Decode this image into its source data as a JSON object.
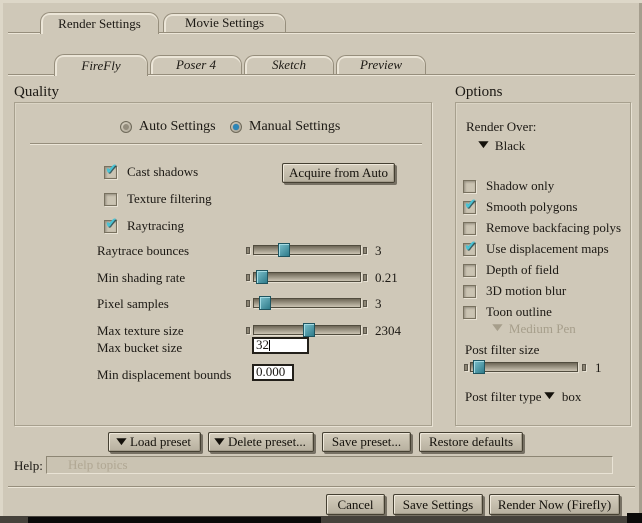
{
  "tabs": {
    "main": [
      {
        "label": "Render Settings",
        "active": true
      },
      {
        "label": "Movie Settings",
        "active": false
      }
    ],
    "sub": [
      {
        "label": "FireFly",
        "active": true
      },
      {
        "label": "Poser 4",
        "active": false
      },
      {
        "label": "Sketch",
        "active": false
      },
      {
        "label": "Preview",
        "active": false
      }
    ]
  },
  "quality": {
    "heading": "Quality",
    "radios": [
      {
        "label": "Auto Settings",
        "selected": false
      },
      {
        "label": "Manual Settings",
        "selected": true
      }
    ],
    "checkboxes": [
      {
        "label": "Cast shadows",
        "checked": true
      },
      {
        "label": "Texture filtering",
        "checked": false
      },
      {
        "label": "Raytracing",
        "checked": true
      }
    ],
    "acquire_button": "Acquire from Auto",
    "sliders": [
      {
        "label": "Raytrace bounces",
        "value": "3",
        "pos": 23
      },
      {
        "label": "Min shading rate",
        "value": "0.21",
        "pos": 2
      },
      {
        "label": "Pixel samples",
        "value": "3",
        "pos": 5
      },
      {
        "label": "Max texture size",
        "value": "2304",
        "pos": 46
      }
    ],
    "inputs": [
      {
        "label": "Max bucket size",
        "value": "32"
      },
      {
        "label": "Min displacement bounds",
        "value": "0.000"
      }
    ]
  },
  "options": {
    "heading": "Options",
    "render_over": {
      "label": "Render Over:",
      "value": "Black"
    },
    "checkboxes": [
      {
        "label": "Shadow only",
        "checked": false
      },
      {
        "label": "Smooth polygons",
        "checked": true
      },
      {
        "label": "Remove backfacing polys",
        "checked": false
      },
      {
        "label": "Use displacement maps",
        "checked": true
      },
      {
        "label": "Depth of field",
        "checked": false
      },
      {
        "label": "3D motion blur",
        "checked": false
      },
      {
        "label": "Toon outline",
        "checked": false
      }
    ],
    "toon_pen": {
      "value": "Medium Pen",
      "disabled": true
    },
    "post_filter_size": {
      "label": "Post filter size",
      "value": "1",
      "pos": 2
    },
    "post_filter_type": {
      "label": "Post filter type",
      "value": "box"
    }
  },
  "presets": {
    "load": "Load preset",
    "delete": "Delete preset...",
    "save": "Save preset...",
    "restore": "Restore defaults"
  },
  "help": {
    "label": "Help:",
    "placeholder": "Help topics"
  },
  "footer": {
    "cancel": "Cancel",
    "save": "Save Settings",
    "render": "Render Now (Firefly)"
  },
  "colors": {
    "bg": "#cfc8b8",
    "check_teal": "#49c2d4",
    "radio_blue": "#2c86b8",
    "slider_handle": "#3f8a9b"
  }
}
